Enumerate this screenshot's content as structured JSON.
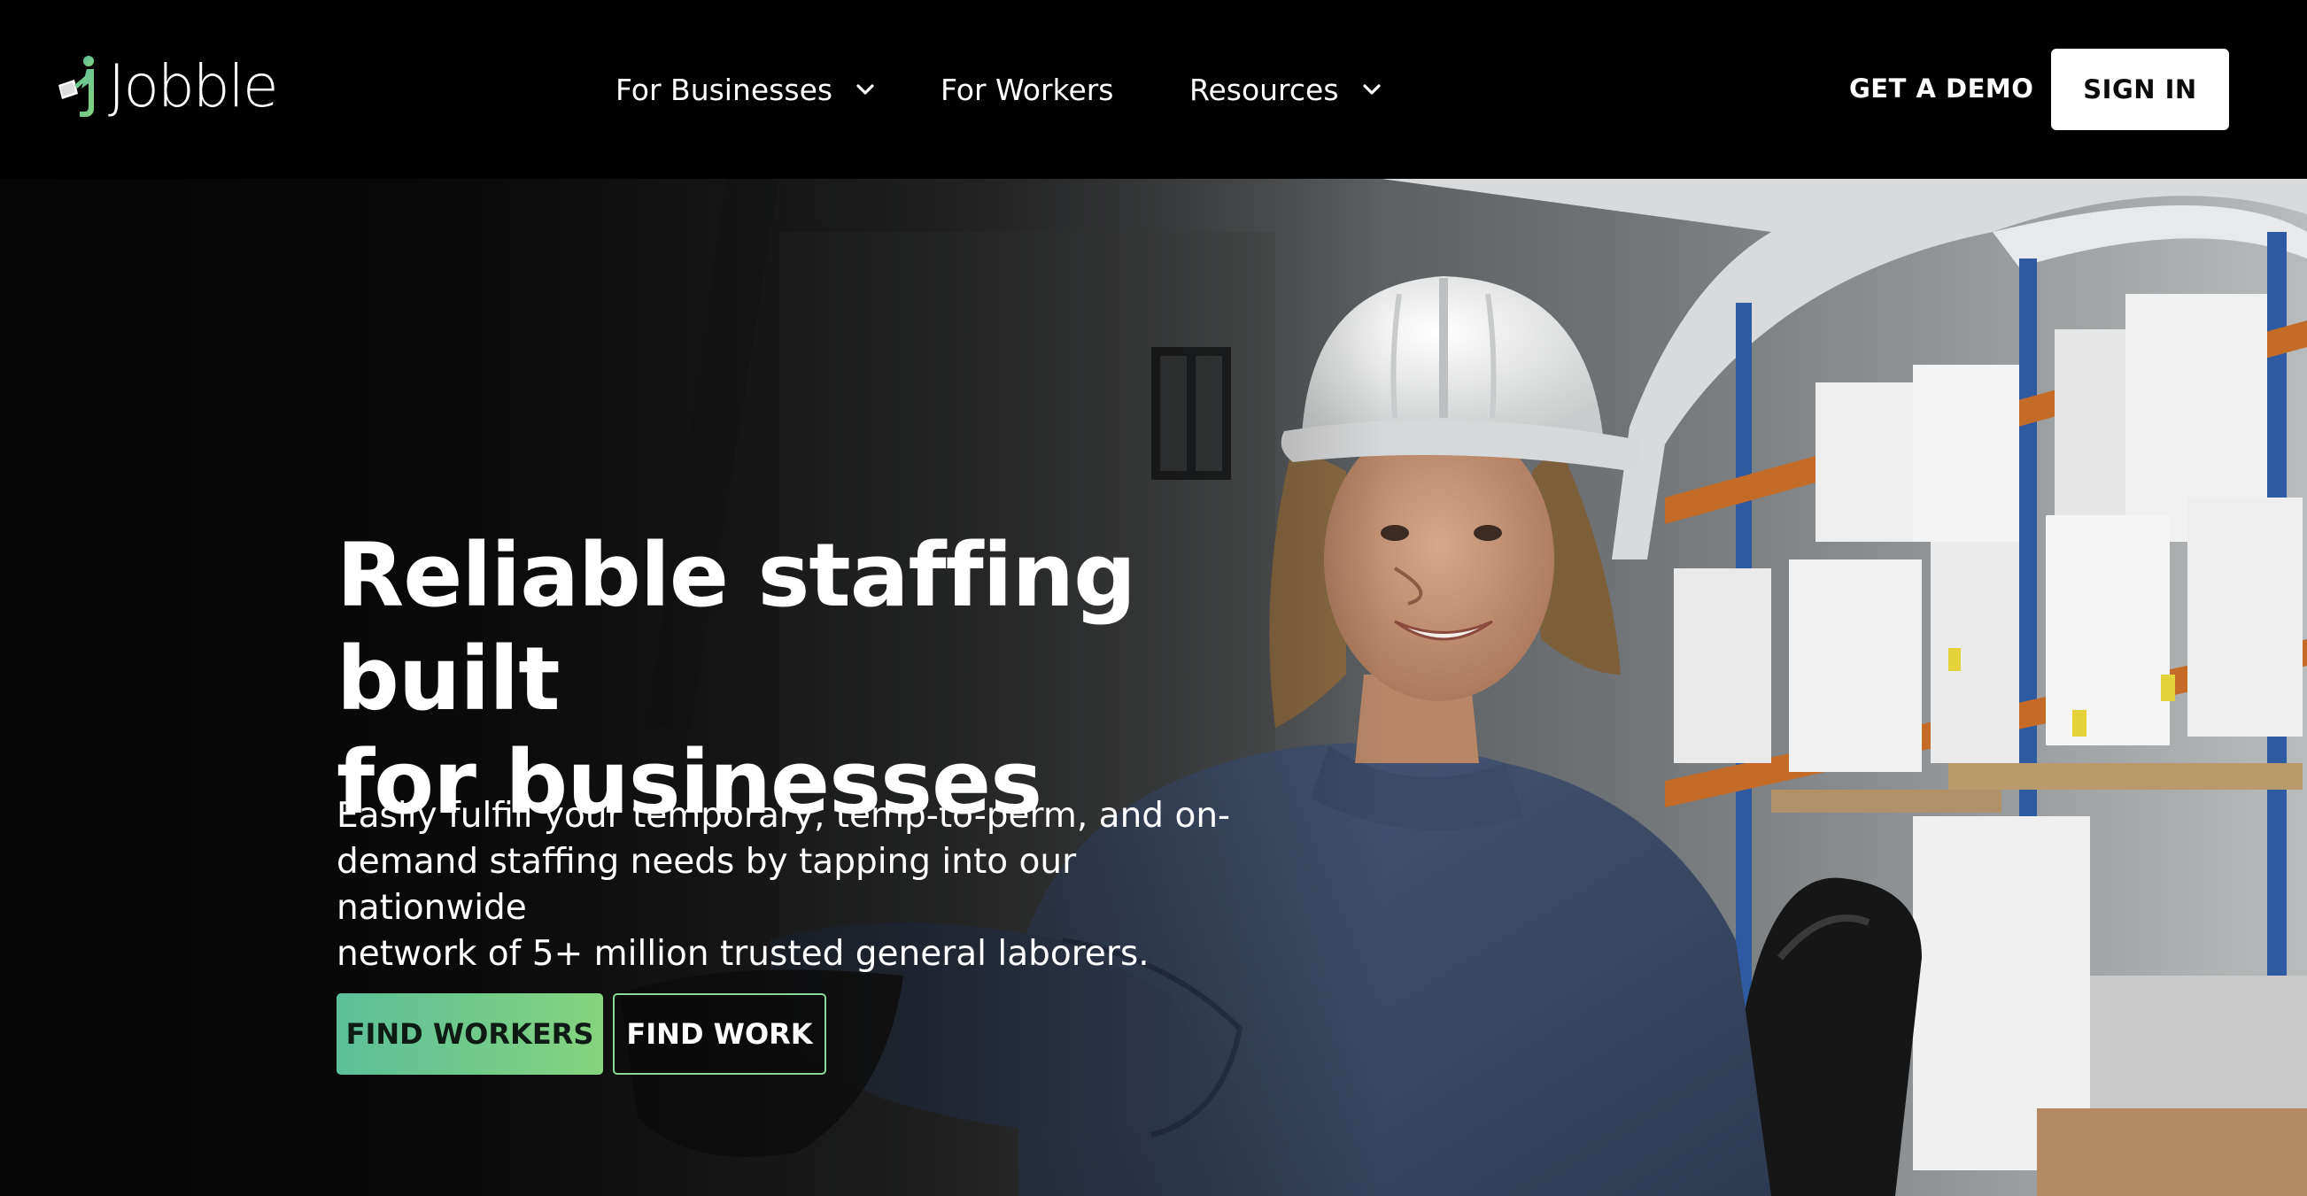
{
  "brand": {
    "name": "Jobble",
    "logo_icon": "jobble-figure-logo",
    "accent_start": "#5bbf9a",
    "accent_end": "#86d37d"
  },
  "nav": {
    "items": [
      {
        "label": "For Businesses",
        "has_dropdown": true,
        "icon": "chevron-down-icon"
      },
      {
        "label": "For Workers",
        "has_dropdown": false
      },
      {
        "label": "Resources",
        "has_dropdown": true,
        "icon": "chevron-down-icon"
      }
    ],
    "get_demo": "GET A DEMO",
    "sign_in": "SIGN IN"
  },
  "hero": {
    "title_line1": "Reliable staffing built",
    "title_line2": "for businesses",
    "subtitle_line1": "Easily fulfill your temporary, temp-to-perm, and on-",
    "subtitle_line2": "demand staffing needs by tapping into our nationwide",
    "subtitle_line3": "network of 5+ million trusted general laborers.",
    "primary_cta": "FIND WORKERS",
    "secondary_cta": "FIND WORK",
    "background_image": "warehouse-forklift-worker-photo"
  }
}
